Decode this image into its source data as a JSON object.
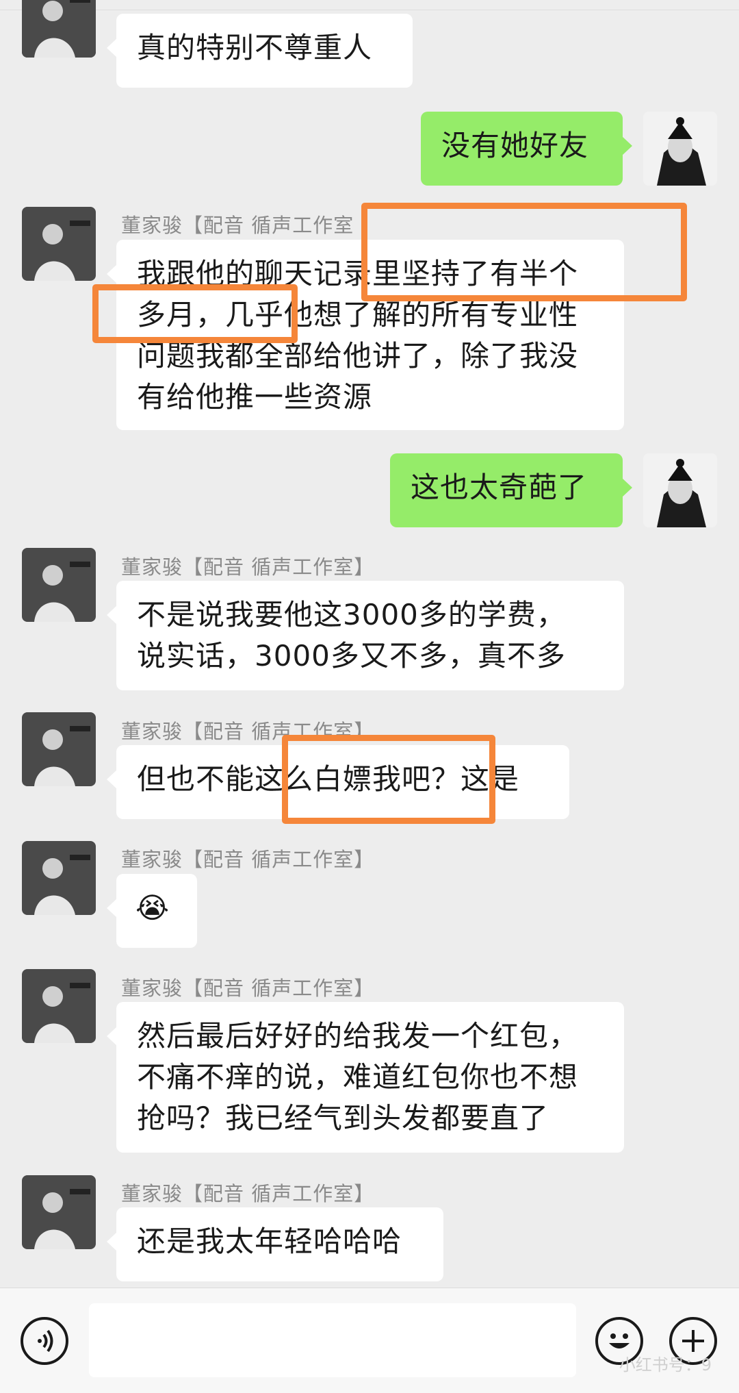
{
  "chat": {
    "messages": [
      {
        "sender": "",
        "text": "真的特别不尊重人"
      },
      {
        "sender": "",
        "text": "没有她好友"
      },
      {
        "sender": "董家骏【配音 循声工作室",
        "lines": [
          "我跟他的聊天记录里坚持了有半个",
          "多月，几乎他想了解的所有专业性",
          "问题我都全部给他讲了，除了我没",
          "有给他推一些资源"
        ]
      },
      {
        "sender": "",
        "text": "这也太奇葩了"
      },
      {
        "sender": "董家骏【配音 循声工作室】",
        "lines": [
          "不是说我要他这3000多的学费，",
          "说实话，3000多又不多，真不多"
        ]
      },
      {
        "sender": "董家骏【配音 循声工作室】",
        "text": "但也不能这么白嫖我吧？这是"
      },
      {
        "sender": "董家骏【配音 循声工作室】",
        "text": "😭"
      },
      {
        "sender": "董家骏【配音 循声工作室】",
        "lines": [
          "然后最后好好的给我发一个红包，",
          "不痛不痒的说，难道红包你也不想",
          "抢吗？我已经气到头发都要直了"
        ]
      },
      {
        "sender": "董家骏【配音 循声工作室】",
        "text": "还是我太年轻哈哈哈"
      }
    ]
  },
  "colors": {
    "background": "#ededed",
    "incoming_bubble": "#ffffff",
    "outgoing_bubble": "#95ec69",
    "highlight": "#f5863a"
  },
  "icons": {
    "voice": "voice-icon",
    "emoji": "emoji-icon",
    "add": "plus-icon"
  },
  "watermark": "小红书号：9"
}
